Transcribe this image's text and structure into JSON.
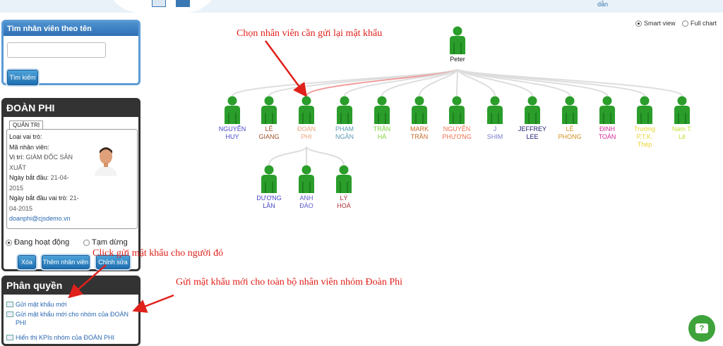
{
  "topbar": {
    "partial_text": "dẫn"
  },
  "search": {
    "title": "Tìm nhân viên theo tên",
    "input_value": "",
    "button": "Tìm kiếm"
  },
  "employee": {
    "name": "ĐOÀN PHI",
    "role_tab": "QUẢN TRỊ",
    "fields": {
      "role_label": "Loại vai trò:",
      "code_label": "Mã nhân viên:",
      "position_label": "Vị trí:",
      "position_value": "GIÁM ĐỐC SẢN XUẤT",
      "position_value_2": "XUẤT",
      "start_label": "Ngày bắt đầu:",
      "start_value": "21-04-",
      "start_value_2": "2015",
      "role_start_label": "Ngày bắt đầu vai trò:",
      "role_start_value": "21-",
      "role_start_value_2": "04-2015",
      "email": "doanphi@cjsdemo.vn"
    },
    "status_active": "Đang hoạt động",
    "status_paused": "Tạm dừng",
    "buttons": {
      "delete": "Xóa",
      "add": "Thêm nhân viên",
      "edit": "Chỉnh sửa"
    }
  },
  "permissions": {
    "title": "Phân quyền",
    "items": [
      "Gửi mật khẩu mới",
      "Gửi mật khẩu mới cho nhóm của ĐOÀN",
      "PHI",
      "Hiển thị KPIs nhóm của ĐOÀN PHI"
    ]
  },
  "view_options": {
    "smart": "Smart view",
    "full": "Full chart"
  },
  "annotations": {
    "choose": "Chọn nhân viên cần gửi lại mật khẩu",
    "click": "Click gửi mật khẩu cho người đó",
    "group": "Gửi mật khẩu mới cho toàn bộ nhân viên nhóm Đoàn Phi"
  },
  "org": {
    "root": "Peter",
    "level1": [
      {
        "l1": "NGUYỄN",
        "l2": "HUY",
        "color": "#4646c8"
      },
      {
        "l1": "LÊ",
        "l2": "GIANG",
        "color": "#a0522d"
      },
      {
        "l1": "ĐOÀN",
        "l2": "PHI",
        "color": "#e8a27a"
      },
      {
        "l1": "PHẠM",
        "l2": "NGÂN",
        "color": "#5a9ab5"
      },
      {
        "l1": "TRẦN",
        "l2": "HÀ",
        "color": "#7bd13a"
      },
      {
        "l1": "MARK",
        "l2": "TRẦN",
        "color": "#c8682a"
      },
      {
        "l1": "NGUYỄN",
        "l2": "PHƯƠNG",
        "color": "#f07050"
      },
      {
        "l1": "J",
        "l2": "SHIM",
        "color": "#7a7ad0"
      },
      {
        "l1": "JEFFREY",
        "l2": "LEE",
        "color": "#1a1a6e"
      },
      {
        "l1": "LÊ",
        "l2": "PHONG",
        "color": "#d2901e"
      },
      {
        "l1": "ĐINH",
        "l2": "TOÀN",
        "color": "#d42a9a"
      },
      {
        "l1": "Trường",
        "l2": "P.T.K.",
        "l3": "Thép",
        "color": "#e8d430"
      },
      {
        "l1": "Nam T.",
        "l2": "Lê",
        "color": "#c8e23a"
      }
    ],
    "level2": [
      {
        "l1": "DƯƠNG",
        "l2": "LÂN",
        "color": "#4646c8"
      },
      {
        "l1": "ANH",
        "l2": "ĐÀO",
        "color": "#5a5ad0"
      },
      {
        "l1": "LÝ",
        "l2": "HOÀ",
        "color": "#b0303a"
      }
    ]
  },
  "colors": {
    "accent": "#2e6fb4",
    "note": "#e0201a",
    "node_green": "#2a9d2a"
  }
}
